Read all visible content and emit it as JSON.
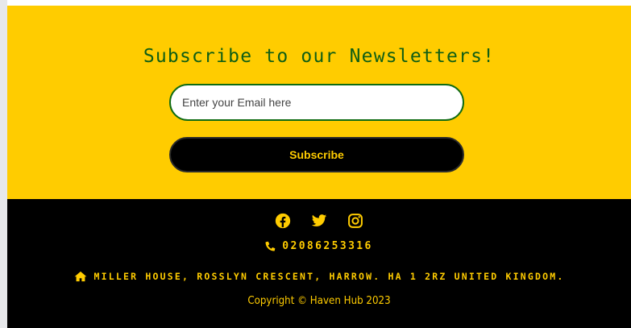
{
  "newsletter": {
    "title": "Subscribe to our Newsletters!",
    "email_placeholder": "Enter your Email here",
    "email_value": "",
    "subscribe_label": "Subscribe"
  },
  "footer": {
    "social_icons": [
      "facebook-icon",
      "twitter-icon",
      "instagram-icon"
    ],
    "phone": "02086253316",
    "address": "MILLER HOUSE, ROSSLYN CRESCENT, HARROW. HA 1 2RZ UNITED KINGDOM.",
    "copyright": "Copyright © Haven Hub 2023"
  },
  "colors": {
    "accent": "#ffcc00",
    "heading_green": "#0f5e14",
    "footer_bg": "#000000"
  }
}
